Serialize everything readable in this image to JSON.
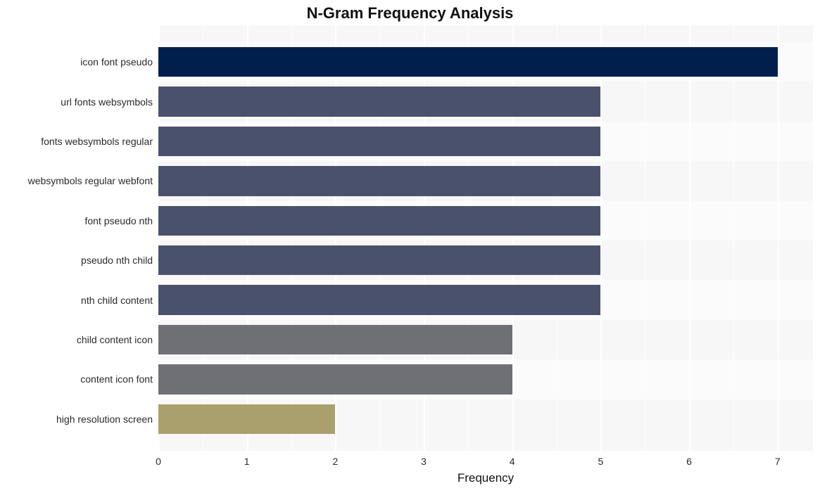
{
  "chart_data": {
    "type": "bar",
    "orientation": "horizontal",
    "title": "N-Gram Frequency Analysis",
    "xlabel": "Frequency",
    "ylabel": "",
    "xlim": [
      0,
      7.4
    ],
    "xticks": [
      0,
      1,
      2,
      3,
      4,
      5,
      6,
      7
    ],
    "categories": [
      "icon font pseudo",
      "url fonts websymbols",
      "fonts websymbols regular",
      "websymbols regular webfont",
      "font pseudo nth",
      "pseudo nth child",
      "nth child content",
      "child content icon",
      "content icon font",
      "high resolution screen"
    ],
    "values": [
      7,
      5,
      5,
      5,
      5,
      5,
      5,
      4,
      4,
      2
    ],
    "colors": [
      "#001f4d",
      "#4a516d",
      "#4a516d",
      "#4a516d",
      "#4a516d",
      "#4a516d",
      "#4a516d",
      "#6f7075",
      "#6f7075",
      "#a9a06e"
    ]
  }
}
